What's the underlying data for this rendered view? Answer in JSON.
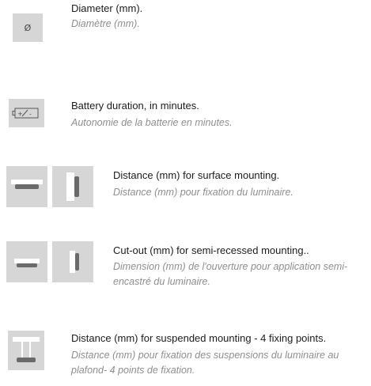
{
  "items": [
    {
      "icon": "diameter-icon",
      "glyph": "Ø",
      "title": "Diameter (mm).",
      "subtitle": "Diamètre (mm)."
    },
    {
      "icon": "battery-icon",
      "glyph": "[+/-]",
      "title": "Battery duration, in minutes.",
      "subtitle": "Autonomie de la batterie en minutes."
    },
    {
      "icon": "surface-mounting-icon",
      "title": "Distance (mm) for surface mounting.",
      "subtitle": "Distance (mm) pour fixation du luminaire."
    },
    {
      "icon": "semi-recessed-cutout-icon",
      "title": "Cut-out (mm) for semi-recessed mounting..",
      "subtitle": "Dimension (mm) de l'ouverture pour application semi-encastré du luminaire."
    },
    {
      "icon": "suspended-mounting-icon",
      "title": "Distance (mm) for suspended mounting - 4 fixing points.",
      "subtitle": "Distance (mm) pour fixation des suspensions du luminaire au plafond- 4 points de fixation."
    }
  ]
}
